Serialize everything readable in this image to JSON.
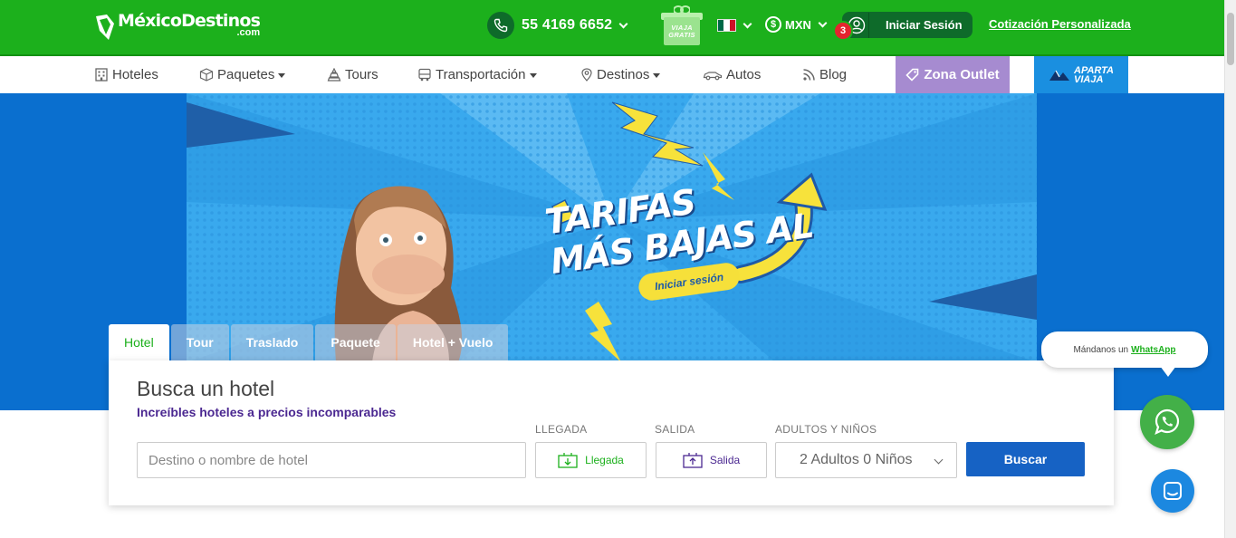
{
  "topbar": {
    "logo_main": "MéxicoDestinos",
    "logo_sub": ".com",
    "phone": "55 4169 6652",
    "gift_line1": "VIAJA",
    "gift_line2": "GRATIS",
    "currency": "MXN",
    "notification_count": "3",
    "login_label": "Iniciar Sesión",
    "quote_link": "Cotización Personalizada",
    "colors": {
      "brand_green": "#1cb01c",
      "dark_green": "#0e6b2a",
      "badge_red": "#e5242e"
    }
  },
  "nav": {
    "items": [
      {
        "label": "Hoteles",
        "icon": "hotel-icon"
      },
      {
        "label": "Paquetes",
        "icon": "package-icon"
      },
      {
        "label": "Tours",
        "icon": "tours-icon"
      },
      {
        "label": "Transportación",
        "icon": "bus-icon"
      },
      {
        "label": "Destinos",
        "icon": "location-icon"
      },
      {
        "label": "Autos",
        "icon": "car-icon"
      },
      {
        "label": "Blog",
        "icon": "rss-icon"
      }
    ],
    "outlet_label": "Zona Outlet",
    "aparta_line1": "APARTA",
    "aparta_line2": "VIAJA",
    "colors": {
      "outlet_bg": "#a68bd0",
      "aparta_bg": "#1a8fe0"
    }
  },
  "banner": {
    "headline_line1": "TARIFAS",
    "headline_line2": "MÁS BAJAS AL",
    "cta": "Iniciar sesión",
    "colors": {
      "hero_bg": "#0a6fcf",
      "banner_bg": "#39a9ee",
      "cta_bg": "#f6e03a"
    }
  },
  "search": {
    "tabs": [
      "Hotel",
      "Tour",
      "Traslado",
      "Paquete",
      "Hotel + Vuelo"
    ],
    "active_tab": "Hotel",
    "title": "Busca un hotel",
    "subtitle": "Increíbles hoteles a precios incomparables",
    "label_arrival": "LLEGADA",
    "label_departure": "SALIDA",
    "label_guests": "ADULTOS Y NIÑOS",
    "destination_placeholder": "Destino o nombre de hotel",
    "arrival_button": "Llegada",
    "departure_button": "Salida",
    "guests_value": "2 Adultos 0 Niños",
    "search_button": "Buscar",
    "colors": {
      "subtitle": "#4b2891",
      "button": "#1662c4"
    }
  },
  "whatsapp": {
    "bubble_text": "Mándanos un",
    "bubble_link": "WhatsApp",
    "icon": "whatsapp-icon"
  },
  "chat": {
    "icon": "chat-icon"
  }
}
